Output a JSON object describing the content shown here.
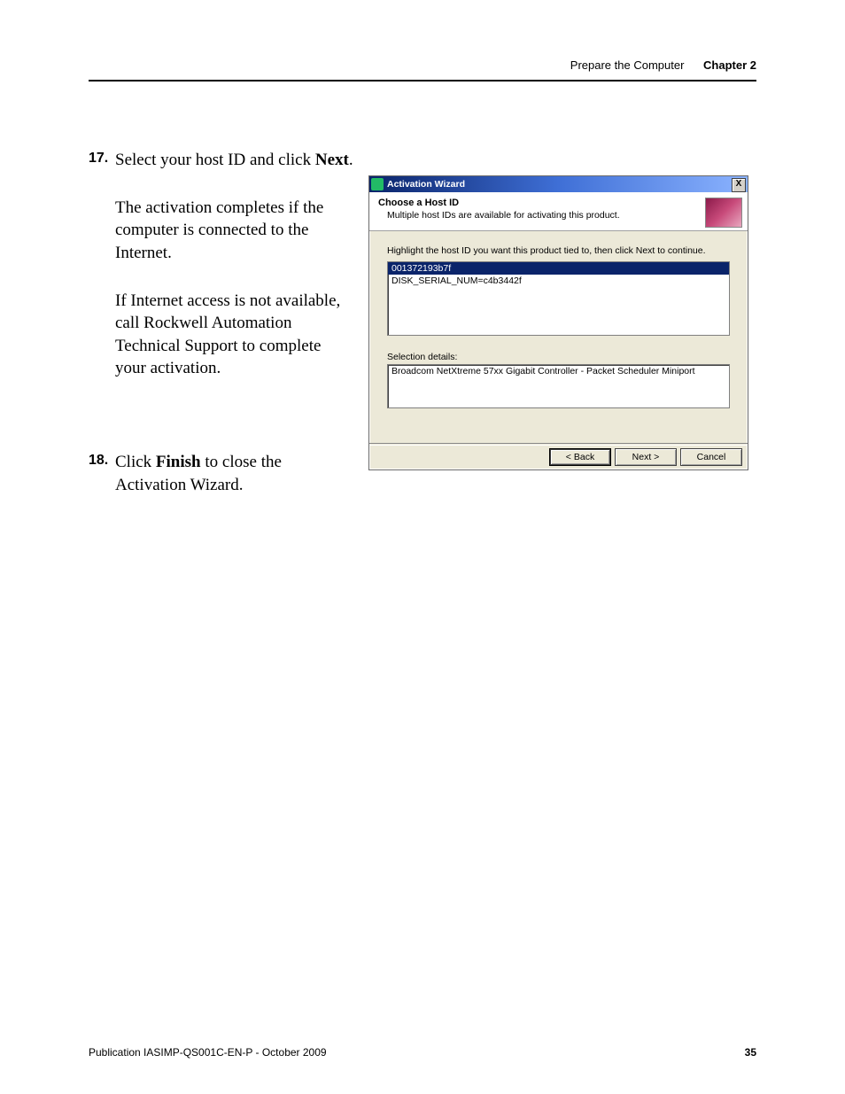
{
  "header": {
    "section": "Prepare the Computer",
    "chapter": "Chapter 2"
  },
  "steps": [
    {
      "num": "17.",
      "lines": [
        {
          "pre": "Select your host ID and click ",
          "bold": "Next",
          "post": "."
        }
      ],
      "paras": [
        "The activation completes if the computer is connected to the Internet.",
        "If Internet access is not available, call Rockwell Automation Technical Support to complete your activation."
      ]
    },
    {
      "num": "18.",
      "lines": [
        {
          "pre": "Click ",
          "bold": "Finish",
          "post": " to close the Activation Wizard."
        }
      ],
      "paras": []
    }
  ],
  "dialog": {
    "title": "Activation Wizard",
    "close": "X",
    "banner_title": "Choose a Host ID",
    "banner_sub": "Multiple host IDs are available for activating this product.",
    "instruction": "Highlight the host ID you want this product tied to, then click Next to continue.",
    "list": [
      "001372193b7f",
      "DISK_SERIAL_NUM=c4b3442f"
    ],
    "sel_label": "Selection details:",
    "sel_value": "Broadcom NetXtreme 57xx Gigabit Controller - Packet Scheduler Miniport",
    "buttons": {
      "back": "< Back",
      "next": "Next >",
      "cancel": "Cancel"
    }
  },
  "footer": {
    "pub": "Publication IASIMP-QS001C-EN-P - October 2009",
    "page": "35"
  }
}
